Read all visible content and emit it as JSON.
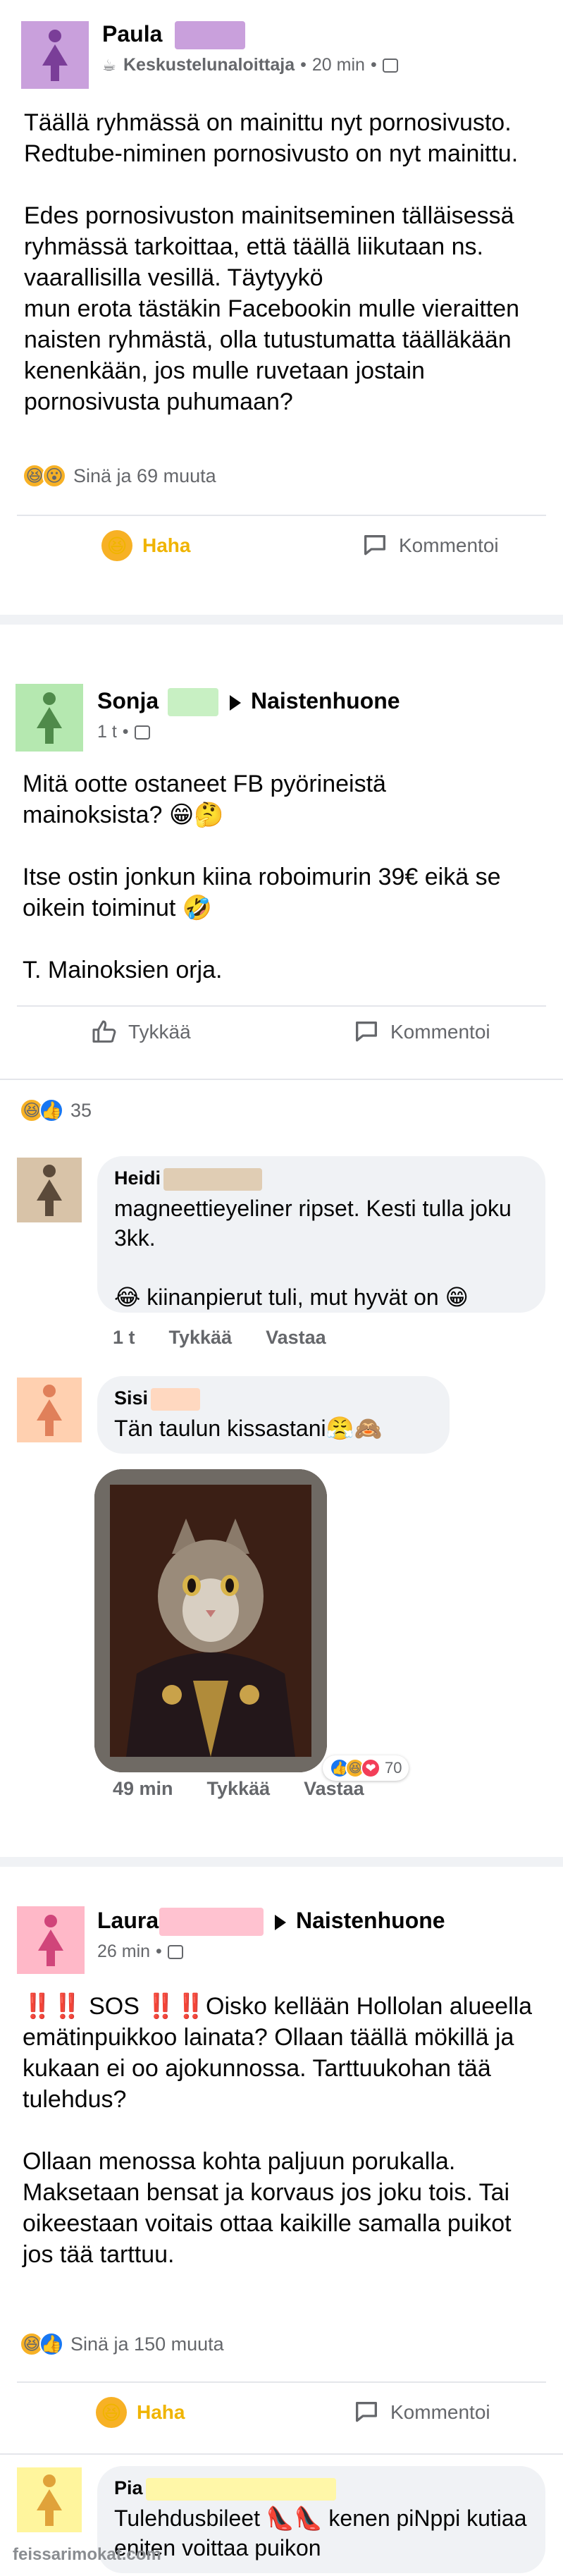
{
  "post1": {
    "author": "Paula",
    "group": "Keskustelunaloittaja",
    "time": "20 min",
    "text": "Täällä ryhmässä on mainittu nyt pornosivusto. Redtube-niminen pornosivusto on nyt mainittu.\n\nEdes pornosivuston mainitseminen tälläisessä ryhmässä tarkoittaa, että täällä liikutaan ns. vaarallisilla vesillä. Täytyykö\nmun erota tästäkin Facebookin mulle vieraitten naisten ryhmästä, olla tutustumatta täälläkään kenenkään, jos mulle ruvetaan jostain pornosivusta puhumaan?",
    "reaction_text": "Sinä ja 69 muuta",
    "haha_label": "Haha",
    "comment_label": "Kommentoi"
  },
  "post2": {
    "author": "Sonja",
    "group": "Naistenhuone",
    "time": "1 t",
    "text": "Mitä ootte ostaneet FB pyörineistä mainoksista? 😁🤔\n\nItse ostin jonkun kiina roboimurin 39€ eikä se oikein toiminut 🤣\n\nT. Mainoksien orja.",
    "like_label": "Tykkää",
    "comment_label": "Kommentoi",
    "reaction_count": "35",
    "comments": [
      {
        "author": "Heidi",
        "text": "magneettieyeliner ripset. Kesti tulla joku 3kk.\n\n😂 kiinanpierut tuli, mut hyvät on 😁",
        "time": "1 t",
        "like": "Tykkää",
        "reply": "Vastaa"
      },
      {
        "author": "Sisi",
        "text": "Tän taulun kissastani😤🙈",
        "time": "49 min",
        "like": "Tykkää",
        "reply": "Vastaa",
        "reaction_count": "70"
      }
    ]
  },
  "post3": {
    "author": "Laura",
    "group": "Naistenhuone",
    "time": "26 min",
    "text": "‼️‼️ SOS ‼️‼️Oisko kellään Hollolan alueella emätinpuikkoo lainata? Ollaan täällä mökillä ja kukaan ei oo ajokunnossa. Tarttuukohan tää tulehdus?\n\nOllaan menossa kohta paljuun porukalla. Maksetaan bensat ja korvaus jos joku tois. Tai oikeestaan voitais ottaa kaikille samalla puikot jos tää tarttuu.",
    "reaction_text": "Sinä ja 150 muuta",
    "haha_label": "Haha",
    "comment_label": "Kommentoi",
    "comments": [
      {
        "author": "Pia",
        "text": "Tulehdusbileet 👠👠 kenen piNppi kutiaa eniten voittaa puikon"
      }
    ]
  },
  "watermark": "feissarimokat.com",
  "colors": {
    "paula_avatar": "#c9a0dc",
    "sonja_avatar": "#b5e8b0",
    "heidi_avatar": "#d8c3a8",
    "sisi_avatar": "#ffd0b0",
    "laura_avatar": "#ffb8c8",
    "pia_avatar": "#fff59d",
    "haha_active": "#f0b400"
  }
}
